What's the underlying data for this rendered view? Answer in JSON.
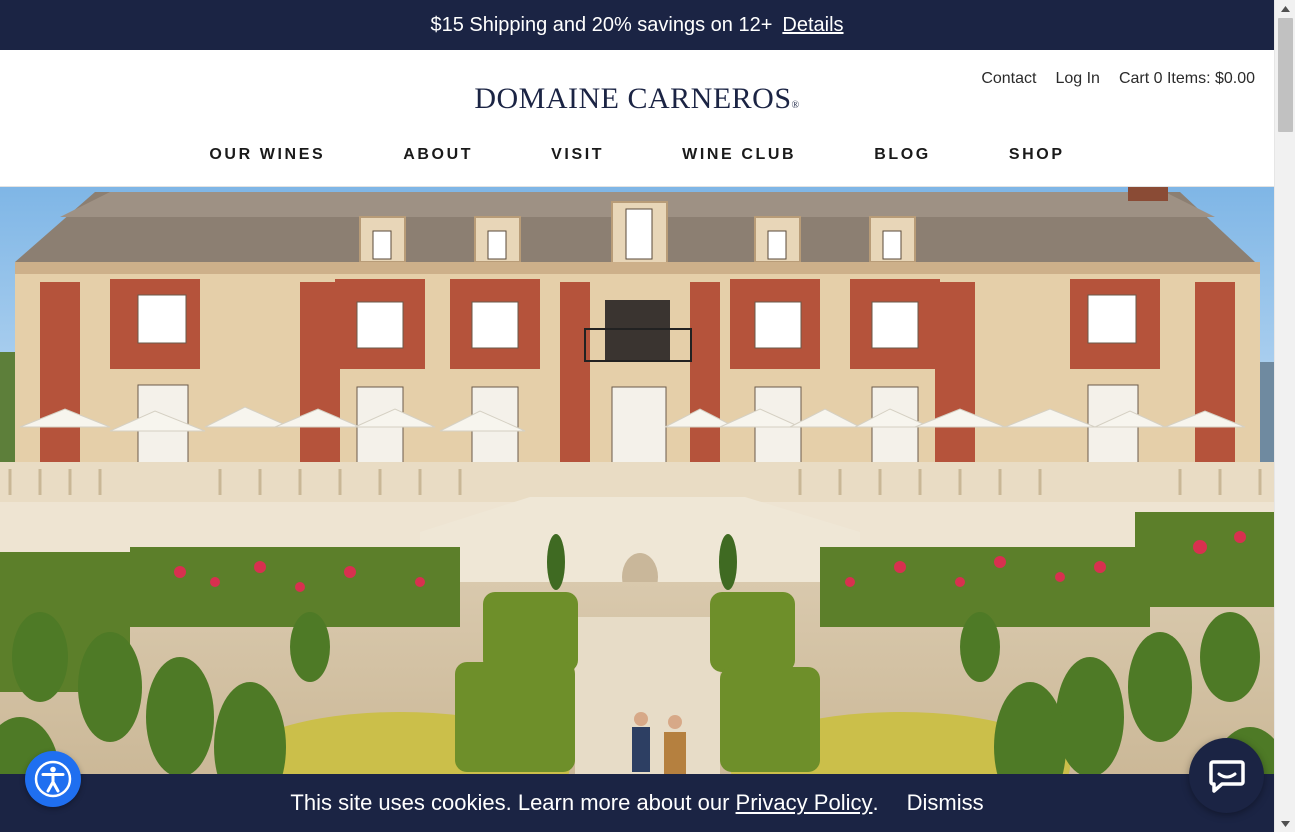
{
  "promo": {
    "text": "$15 Shipping and 20% savings on 12+",
    "link": "Details"
  },
  "header": {
    "logo": "DOMAINE CARNEROS",
    "utility": {
      "contact": "Contact",
      "login": "Log In",
      "cart": "Cart 0 Items: $0.00"
    },
    "nav": [
      "OUR WINES",
      "ABOUT",
      "VISIT",
      "WINE CLUB",
      "BLOG",
      "SHOP"
    ]
  },
  "hero": {
    "icon": "chateau-photo"
  },
  "cookie": {
    "text": "This site uses cookies. Learn more about our",
    "link": "Privacy Policy",
    "after": ".",
    "dismiss": "Dismiss"
  },
  "floating": {
    "accessibility_icon": "accessibility-icon",
    "chat_icon": "chat-icon"
  },
  "colors": {
    "navy": "#1b2444",
    "accessibility_blue": "#1f6ff0"
  }
}
